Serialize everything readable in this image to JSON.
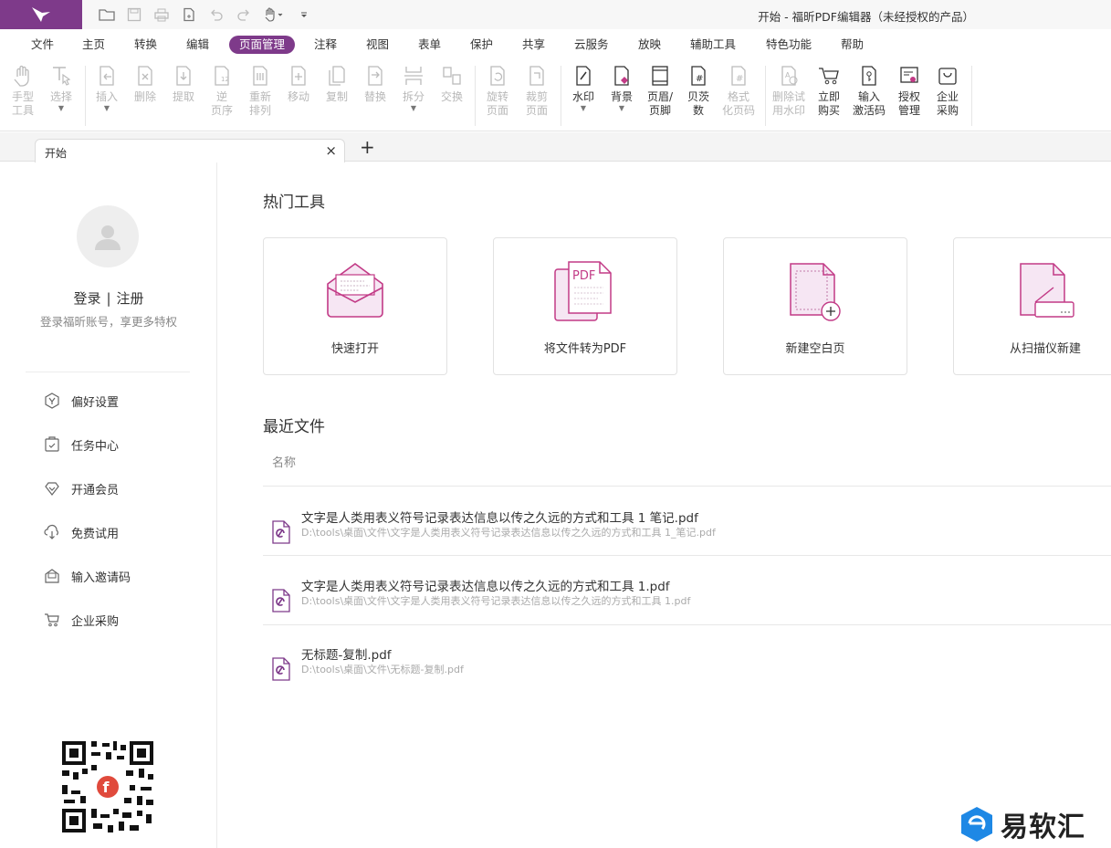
{
  "window": {
    "title": "开始 - 福昕PDF编辑器（未经授权的产品）"
  },
  "menu": [
    "文件",
    "主页",
    "转换",
    "编辑",
    "页面管理",
    "注释",
    "视图",
    "表单",
    "保护",
    "共享",
    "云服务",
    "放映",
    "辅助工具",
    "特色功能",
    "帮助"
  ],
  "ribbon": [
    {
      "label": "手型\n工具",
      "icon": "hand-icon",
      "enabled": false
    },
    {
      "label": "选择",
      "icon": "select-icon",
      "enabled": false
    },
    {
      "label": "插入",
      "icon": "insert-icon",
      "enabled": false
    },
    {
      "label": "删除",
      "icon": "delete-page-icon",
      "enabled": false
    },
    {
      "label": "提取",
      "icon": "extract-icon",
      "enabled": false
    },
    {
      "label": "逆\n页序",
      "icon": "reverse-icon",
      "enabled": false
    },
    {
      "label": "重新\n排列",
      "icon": "rearrange-icon",
      "enabled": false
    },
    {
      "label": "移动",
      "icon": "move-icon",
      "enabled": false
    },
    {
      "label": "复制",
      "icon": "copy-icon",
      "enabled": false
    },
    {
      "label": "替换",
      "icon": "replace-icon",
      "enabled": false
    },
    {
      "label": "拆分",
      "icon": "split-icon",
      "enabled": false
    },
    {
      "label": "交换",
      "icon": "swap-icon",
      "enabled": false
    },
    {
      "label": "旋转\n页面",
      "icon": "rotate-icon",
      "enabled": false
    },
    {
      "label": "裁剪\n页面",
      "icon": "crop-icon",
      "enabled": false
    },
    {
      "label": "水印",
      "icon": "watermark-icon",
      "enabled": true
    },
    {
      "label": "背景",
      "icon": "background-icon",
      "enabled": true
    },
    {
      "label": "页眉/\n页脚",
      "icon": "header-footer-icon",
      "enabled": true
    },
    {
      "label": "贝茨\n数",
      "icon": "bates-icon",
      "enabled": true
    },
    {
      "label": "格式\n化页码",
      "icon": "format-page-number-icon",
      "enabled": false
    },
    {
      "label": "删除试\n用水印",
      "icon": "remove-trial-watermark-icon",
      "enabled": false
    },
    {
      "label": "立即\n购买",
      "icon": "cart-icon",
      "enabled": true
    },
    {
      "label": "输入\n激活码",
      "icon": "activation-code-icon",
      "enabled": true
    },
    {
      "label": "授权\n管理",
      "icon": "license-icon",
      "enabled": true
    },
    {
      "label": "企业\n采购",
      "icon": "enterprise-bag-icon",
      "enabled": true
    }
  ],
  "tab": {
    "label": "开始",
    "close": "×",
    "add": "+"
  },
  "sidebar": {
    "login": "登录",
    "separator": "|",
    "register": "注册",
    "subtitle": "登录福昕账号，享更多特权",
    "items": [
      "偏好设置",
      "任务中心",
      "开通会员",
      "免费试用",
      "输入邀请码",
      "企业采购"
    ]
  },
  "hot_tools": {
    "title": "热门工具",
    "items": [
      "快速打开",
      "将文件转为PDF",
      "新建空白页",
      "从扫描仪新建"
    ]
  },
  "recent": {
    "title": "最近文件",
    "column": "名称",
    "files": [
      {
        "name": "文字是人类用表义符号记录表达信息以传之久远的方式和工具 1 笔记.pdf",
        "path": "D:\\tools\\桌面\\文件\\文字是人类用表义符号记录表达信息以传之久远的方式和工具 1_笔记.pdf"
      },
      {
        "name": "文字是人类用表义符号记录表达信息以传之久远的方式和工具 1.pdf",
        "path": "D:\\tools\\桌面\\文件\\文字是人类用表义符号记录表达信息以传之久远的方式和工具 1.pdf"
      },
      {
        "name": "无标题-复制.pdf",
        "path": "D:\\tools\\桌面\\文件\\无标题-复制.pdf"
      }
    ]
  },
  "card_icon_label": "PDF",
  "brand": "易软汇",
  "colors": {
    "accent": "#7e3a8a",
    "icon_pink": "#c23a86",
    "icon_fill": "#f6e6f3"
  }
}
